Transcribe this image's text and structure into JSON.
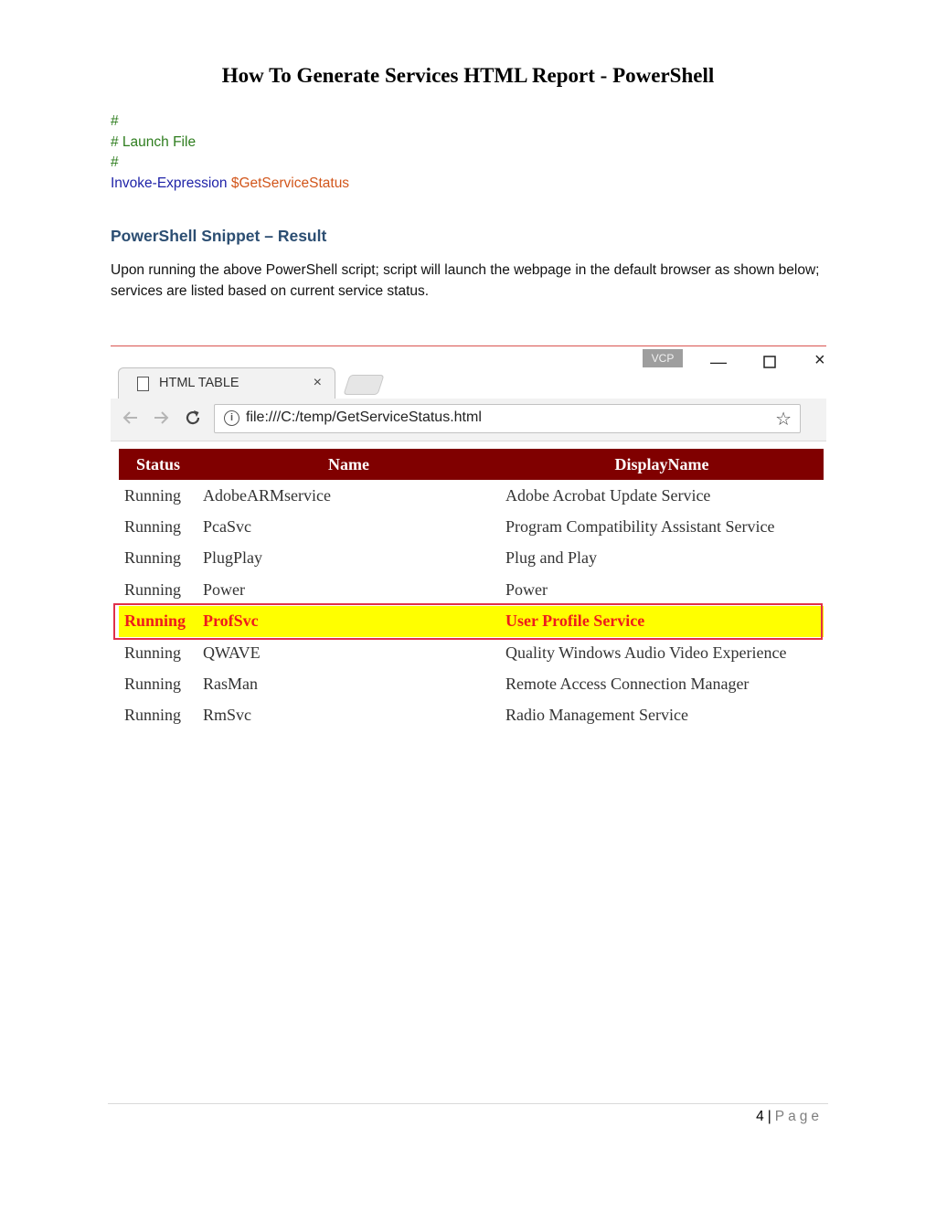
{
  "document": {
    "title": "How To Generate Services HTML Report - PowerShell",
    "code": {
      "line1": "#",
      "line2": "# Launch File",
      "line3": "#",
      "cmdlet": "Invoke-Expression",
      "variable": "$GetServiceStatus"
    },
    "section_heading": "PowerShell Snippet – Result",
    "paragraph": "Upon running the above PowerShell script; script will launch the webpage in the default browser as shown below; services are listed based on current service status."
  },
  "browser": {
    "badge": "VCP",
    "tab_title": "HTML TABLE",
    "tab_close": "×",
    "url": "file:///C:/temp/GetServiceStatus.html",
    "icons": {
      "minimize": "minimize-icon",
      "maximize": "maximize-icon",
      "close": "close-icon",
      "back": "back-arrow-icon",
      "forward": "forward-arrow-icon",
      "reload": "reload-icon",
      "info": "info-icon",
      "star": "star-icon",
      "page": "document-icon"
    },
    "colors": {
      "header_bg": "#800000",
      "highlight_bg": "#ffff00",
      "highlight_text": "#ee1c1c",
      "highlight_border": "#e0304a"
    }
  },
  "table": {
    "headers": [
      "Status",
      "Name",
      "DisplayName"
    ],
    "rows": [
      {
        "status": "Running",
        "name": "AdobeARMservice",
        "display": "Adobe Acrobat Update Service"
      },
      {
        "status": "Running",
        "name": "PcaSvc",
        "display": "Program Compatibility Assistant Service"
      },
      {
        "status": "Running",
        "name": "PlugPlay",
        "display": "Plug and Play"
      },
      {
        "status": "Running",
        "name": "Power",
        "display": "Power"
      },
      {
        "status": "Running",
        "name": "ProfSvc",
        "display": "User Profile Service"
      },
      {
        "status": "Running",
        "name": "QWAVE",
        "display": "Quality Windows Audio Video Experience"
      },
      {
        "status": "Running",
        "name": "RasMan",
        "display": "Remote Access Connection Manager"
      },
      {
        "status": "Running",
        "name": "RmSvc",
        "display": "Radio Management Service"
      }
    ],
    "highlighted_row_index": 4
  },
  "footer": {
    "page_number": "4",
    "separator": "|",
    "page_word": "Page"
  }
}
